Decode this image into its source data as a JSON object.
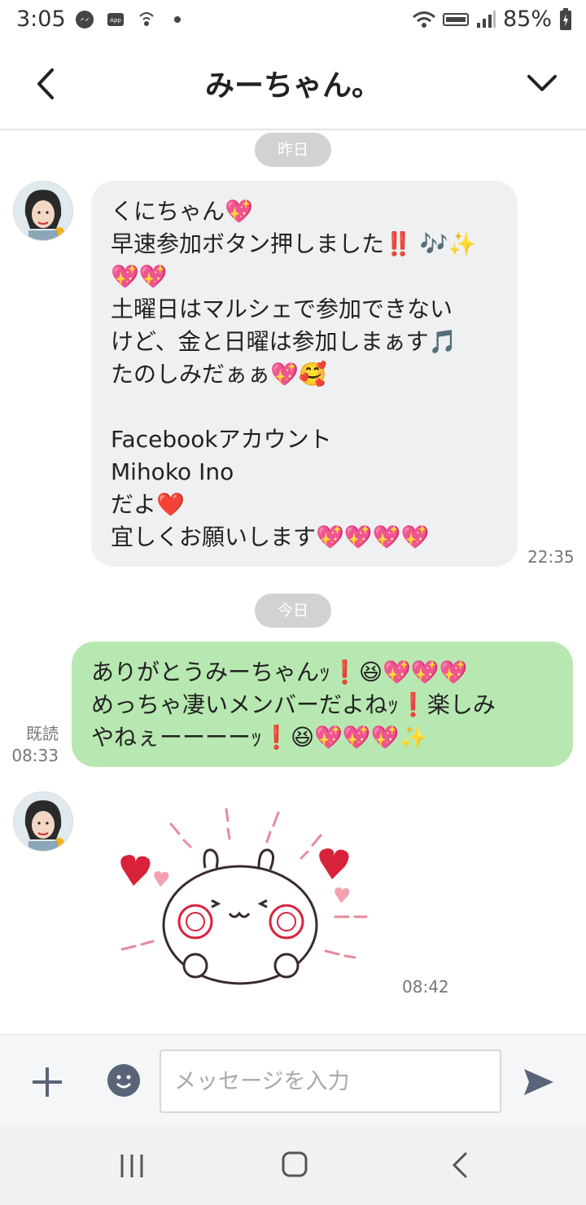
{
  "status_bar": {
    "time": "3:05",
    "battery": "85%"
  },
  "header": {
    "title": "みーちゃん。"
  },
  "chat": {
    "date_yesterday": "昨日",
    "date_today": "今日",
    "incoming_1": {
      "lines": [
        "くにちゃん💖",
        "早速参加ボタン押しました‼️ 🎶✨",
        "💖💖",
        "土曜日はマルシェで参加できない",
        "けど、金と日曜は参加しまぁす🎵",
        "たのしみだぁぁ💖🥰",
        "",
        "Facebookアカウント",
        "Mihoko Ino",
        "だよ❤️",
        "宜しくお願いします💖💖💖💖"
      ],
      "time": "22:35"
    },
    "outgoing_1": {
      "lines": [
        "ありがとうみーちゃんｯ❗😆💖💖💖",
        "めっちゃ凄いメンバーだよねｯ❗楽しみ",
        "やねぇーーーーｯ❗😆💖💖💖✨"
      ],
      "read_label": "既読",
      "time": "08:33"
    },
    "sticker_time": "08:42"
  },
  "input_bar": {
    "placeholder": "メッセージを入力"
  }
}
